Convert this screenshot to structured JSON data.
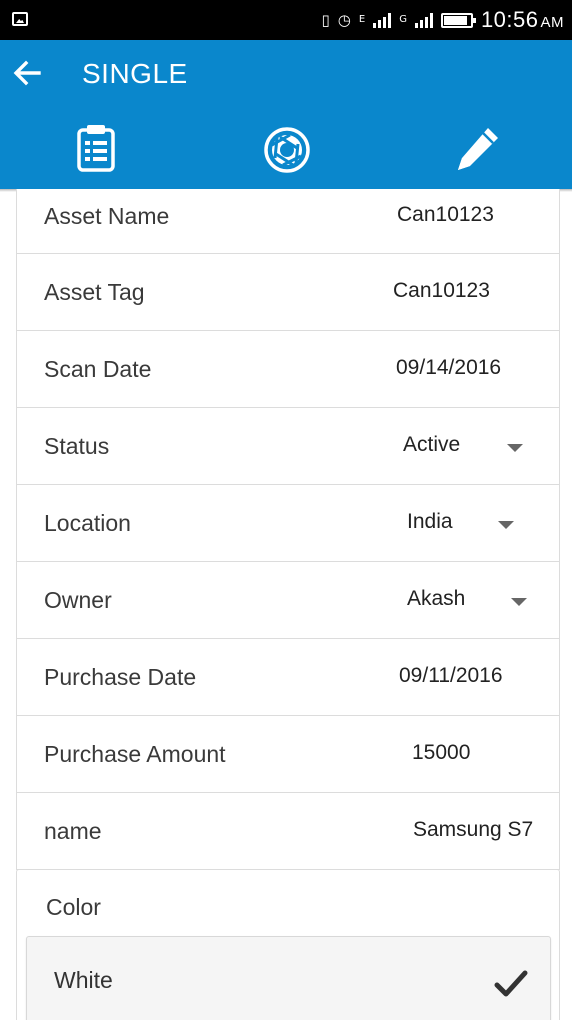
{
  "status_bar": {
    "time": "10:56",
    "ampm": "AM",
    "network_1": "E",
    "network_2": "G",
    "icons": [
      "gallery-icon",
      "vibrate-icon",
      "alarm-icon",
      "signal-icon",
      "battery-icon"
    ],
    "battery_level": 0.9
  },
  "app_bar": {
    "title": "SINGLE",
    "tabs": [
      {
        "icon": "clipboard-icon"
      },
      {
        "icon": "camera-aperture-icon"
      },
      {
        "icon": "pencil-icon"
      }
    ],
    "color": "#0a87cc"
  },
  "form": {
    "rows": [
      {
        "label": "Asset Name",
        "value": "Can10123",
        "dropdown": false
      },
      {
        "label": "Asset Tag",
        "value": "Can10123",
        "dropdown": false
      },
      {
        "label": "Scan Date",
        "value": "09/14/2016",
        "dropdown": false
      },
      {
        "label": "Status",
        "value": "Active",
        "dropdown": true
      },
      {
        "label": "Location",
        "value": "India",
        "dropdown": true
      },
      {
        "label": "Owner",
        "value": "Akash",
        "dropdown": true
      },
      {
        "label": "Purchase Date",
        "value": "09/11/2016",
        "dropdown": false
      },
      {
        "label": "Purchase Amount",
        "value": "15000",
        "dropdown": false
      },
      {
        "label": "name",
        "value": "Samsung S7",
        "dropdown": false
      }
    ],
    "color": {
      "label": "Color",
      "options": [
        {
          "label": "White",
          "checked": true
        }
      ]
    }
  }
}
